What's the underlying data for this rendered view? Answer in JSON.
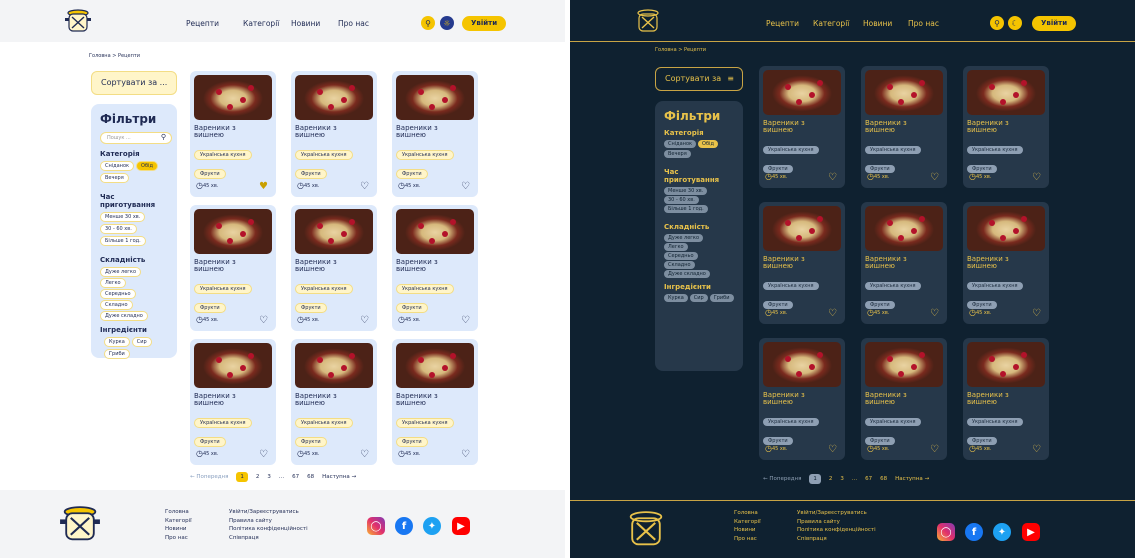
{
  "nav": [
    "Рецепти",
    "Категорії",
    "Новини",
    "Про нас"
  ],
  "login": "Увійти",
  "breadcrumb": "Головна > Рецепти",
  "sort_light": "Сортувати за ...",
  "sort_dark": "Сортувати за",
  "filters": {
    "title": "Фільтри",
    "search_placeholder": "Пошук ...",
    "category_title": "Категорія",
    "categories": [
      "Сніданок",
      "Обід",
      "Вечеря"
    ],
    "time_title": "Час приготування",
    "times": [
      "Менше 30 хв.",
      "30 - 60 хв.",
      "Більше 1 год."
    ],
    "difficulty_title": "Складність",
    "difficulties": [
      "Дуже легко",
      "Легко",
      "Середньо",
      "Складно",
      "Дуже складно"
    ],
    "ingredients_title": "Інгредієнти",
    "ingredients": [
      "Курка",
      "Сир",
      "Гриби"
    ]
  },
  "card": {
    "title_line1": "Вареники з",
    "title_line2": "вишнею",
    "tag_cuisine": "Українська кухня",
    "tag_fruit": "Фрукти",
    "time": "45 хв."
  },
  "pager": {
    "prev": "← Попередня",
    "pages": [
      "1",
      "2",
      "3",
      "...",
      "67",
      "68"
    ],
    "next": "Наступна →"
  },
  "footer": {
    "col1": [
      "Головна",
      "Категорії",
      "Новини",
      "Про нас"
    ],
    "col2": [
      "Увійти/Зареєструватись",
      "Правила сайту",
      "Політика конфіденційності",
      "Співпраця"
    ]
  },
  "icons": {
    "search": "search-icon",
    "theme_light": "sun-icon",
    "theme_dark": "moon-icon",
    "favorite": "heart-icon",
    "clock": "clock-icon",
    "social": [
      "instagram-icon",
      "facebook-icon",
      "twitter-icon",
      "youtube-icon"
    ]
  },
  "colors": {
    "accent": "#f5c400",
    "navy": "#1f2a53",
    "light_card": "#dde9fb",
    "dark_bg": "#0f2130",
    "dark_card": "#26384a",
    "dark_text": "#e8c24a"
  }
}
